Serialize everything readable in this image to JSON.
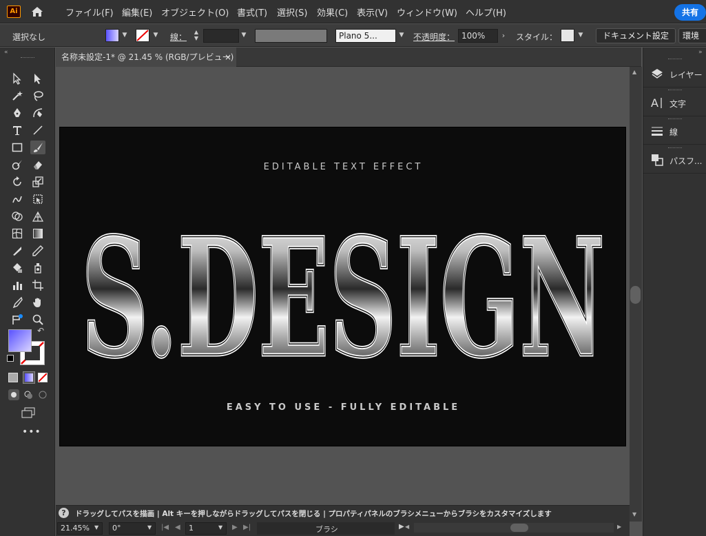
{
  "app": {
    "logo": "Ai",
    "share_label": "共有"
  },
  "menu": [
    "ファイル(F)",
    "編集(E)",
    "オブジェクト(O)",
    "書式(T)",
    "選択(S)",
    "効果(C)",
    "表示(V)",
    "ウィンドウ(W)",
    "ヘルプ(H)"
  ],
  "control": {
    "selection_label": "選択なし",
    "stroke_label": "線：",
    "brush_name": "Plano 5...",
    "opacity_label": "不透明度：",
    "opacity_value": "100%",
    "style_label": "スタイル：",
    "doc_settings_label": "ドキュメント設定",
    "env_label": "環境"
  },
  "tab": {
    "title": "名称未設定-1* @ 21.45 % (RGB/プレビュー)",
    "close": "×"
  },
  "artwork": {
    "top_text": "EDITABLE TEXT EFFECT",
    "main_text": "S.DESIGN",
    "bottom_text": "EASY TO USE - FULLY EDITABLE"
  },
  "panels": [
    {
      "label": "レイヤー",
      "icon": "layers-icon"
    },
    {
      "label": "文字",
      "icon": "character-icon"
    },
    {
      "label": "線",
      "icon": "stroke-icon"
    },
    {
      "label": "パスフ...",
      "icon": "pathfinder-icon"
    }
  ],
  "status": {
    "help": "?",
    "message": "ドラッグしてパスを描画 | Alt キーを押しながらドラッグしてパスを閉じる | プロパティパネルのブラシメニューからブラシをカスタマイズします"
  },
  "bottom": {
    "zoom": "21.45%",
    "rotation": "0°",
    "artboard": "1",
    "tool_name": "ブラシ"
  },
  "colors": {
    "accent": "#1473e6",
    "fill_gradient_start": "#5a52ff",
    "fill_gradient_end": "#d9d4ff",
    "logo": "#ff9a00"
  }
}
